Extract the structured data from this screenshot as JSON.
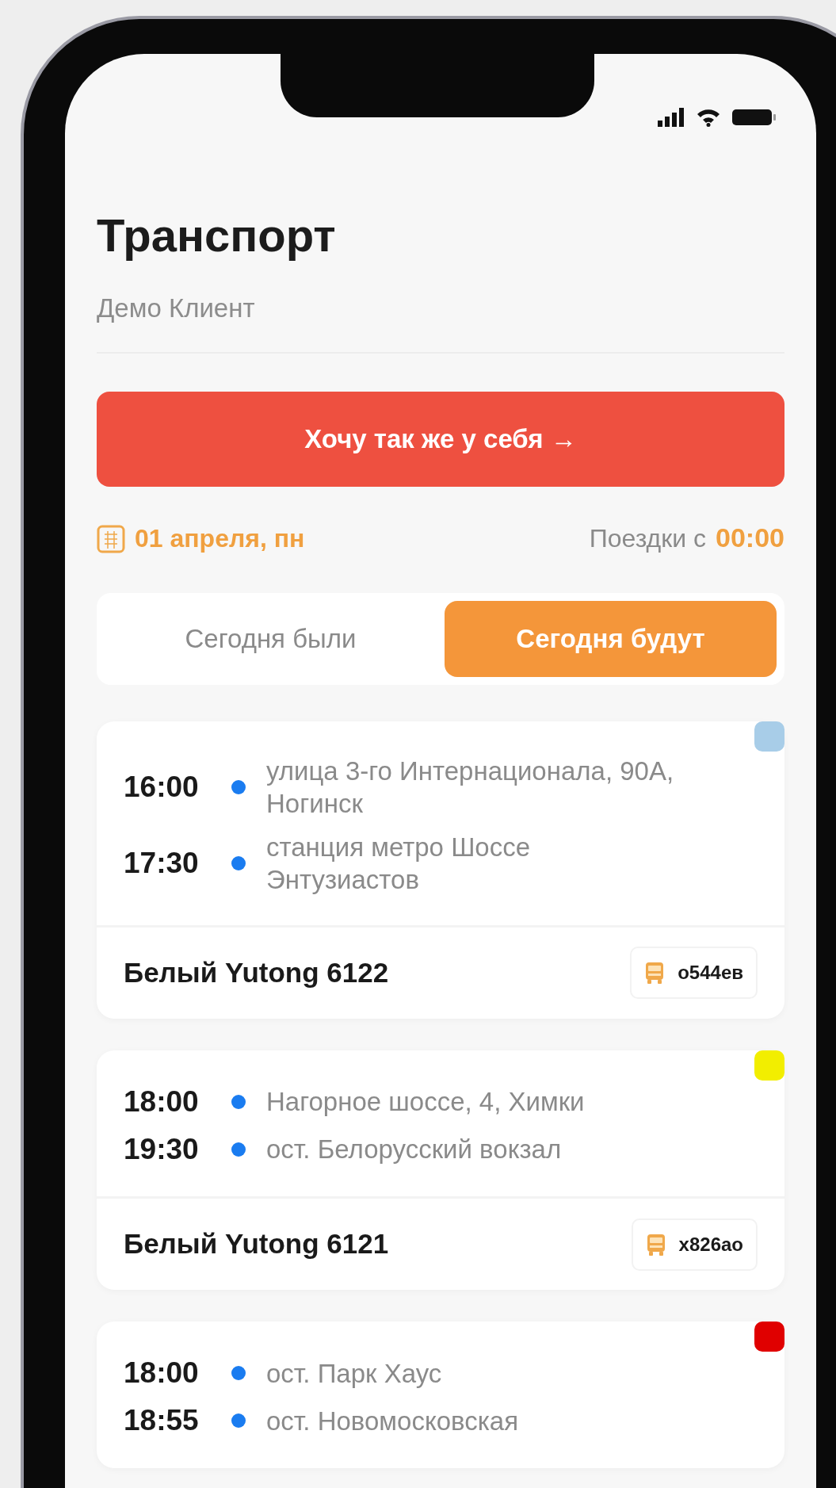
{
  "title": "Транспорт",
  "subtitle": "Демо Клиент",
  "cta": "Хочу так же у себя →",
  "date": "01 апреля, пн",
  "trips_from": {
    "label": "Поездки с",
    "time": "00:00"
  },
  "tabs": [
    {
      "label": "Сегодня были",
      "selected": false
    },
    {
      "label": "Сегодня будут",
      "selected": true
    }
  ],
  "trips": [
    {
      "color": "#a8cde8",
      "stops": [
        {
          "time": "16:00",
          "address": "улица 3-го Интернационала, 90А, Ногинск"
        },
        {
          "time": "17:30",
          "address": "станция метро Шоссе Энтузиастов"
        }
      ],
      "vehicle": "Белый Yutong 6122",
      "plate": "о544ев"
    },
    {
      "color": "#f2ee00",
      "stops": [
        {
          "time": "18:00",
          "address": "Нагорное шоссе, 4, Химки"
        },
        {
          "time": "19:30",
          "address": "ост. Белорусский вокзал"
        }
      ],
      "vehicle": "Белый Yutong 6121",
      "plate": "х826ао"
    },
    {
      "color": "#e00000",
      "stops": [
        {
          "time": "18:00",
          "address": "ост. Парк Хаус"
        },
        {
          "time": "18:55",
          "address": "ост. Новомосковская"
        }
      ]
    }
  ]
}
